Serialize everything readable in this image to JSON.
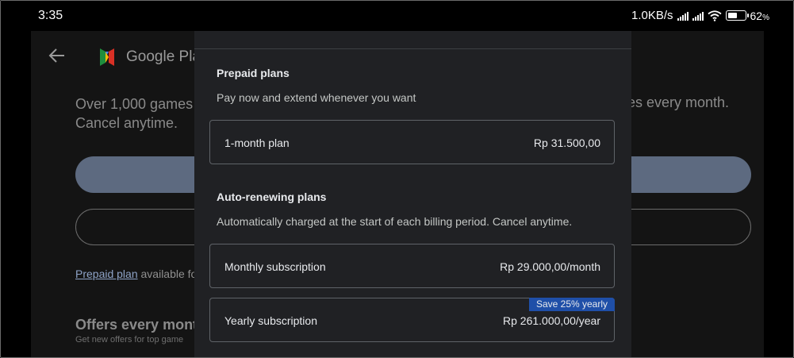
{
  "status_bar": {
    "time": "3:35",
    "speed": "1.0KB/s",
    "battery_level": 0.62,
    "battery_text": "62",
    "battery_unit": "%",
    "icons": [
      "signal-icon",
      "wifi-icon",
      "battery-icon"
    ]
  },
  "background": {
    "app_title": "Google Pla",
    "description_line1": "Over 1,000 games",
    "description_line2": "Cancel anytime.",
    "description_right": "es every month.",
    "prepaid_link": "Prepaid plan",
    "prepaid_rest": " available fo",
    "offers_title": "Offers every mont",
    "offers_subtitle": "Get new offers for top game",
    "icons": [
      "back-arrow-icon",
      "google-play-pass-logo"
    ]
  },
  "sheet": {
    "prepaid": {
      "title": "Prepaid plans",
      "description": "Pay now and extend whenever you want",
      "plans": [
        {
          "name": "1-month plan",
          "price": "Rp 31.500,00"
        }
      ]
    },
    "auto_renewing": {
      "title": "Auto-renewing plans",
      "description": "Automatically charged at the start of each billing period. Cancel anytime.",
      "plans": [
        {
          "name": "Monthly subscription",
          "price": "Rp 29.000,00/month"
        },
        {
          "name": "Yearly subscription",
          "price": "Rp 261.000,00/year",
          "badge": "Save 25% yearly"
        }
      ]
    }
  },
  "colors": {
    "sheet_background": "#202124",
    "badge": "#1f4fa8",
    "background_button": "#5d6a80"
  }
}
